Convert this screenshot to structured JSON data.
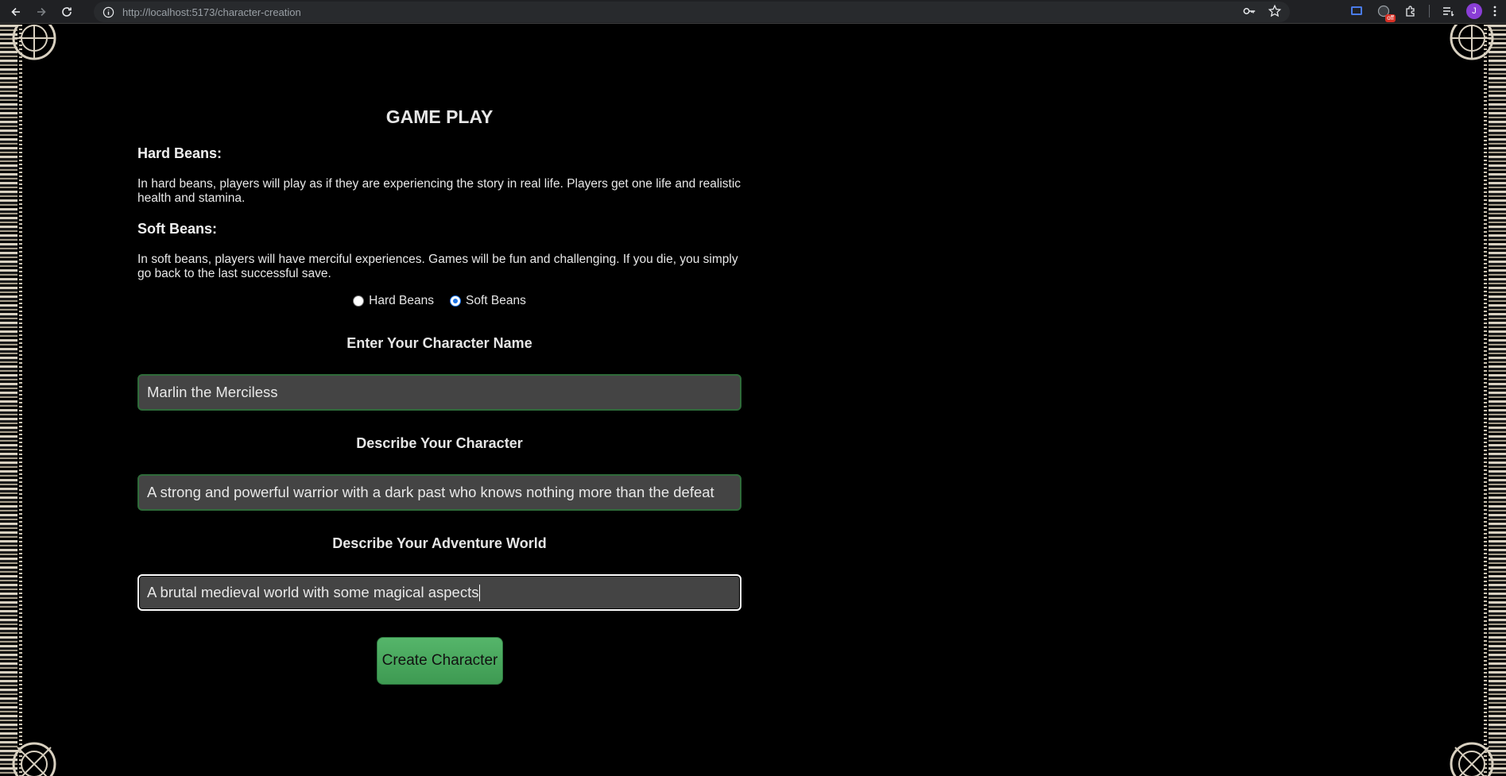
{
  "browser": {
    "url_host": "http://localhost",
    "url_rest": ":5173/character-creation",
    "profile_initial": "J",
    "extension_badge": "off"
  },
  "page": {
    "title": "GAME PLAY",
    "modes": [
      {
        "heading": "Hard Beans:",
        "description": "In hard beans, players will play as if they are experiencing the story in real life. Players get one life and realistic health and stamina."
      },
      {
        "heading": "Soft Beans:",
        "description": "In soft beans, players will have merciful experiences. Games will be fun and challenging. If you die, you simply go back to the last successful save."
      }
    ],
    "radio_options": [
      {
        "label": "Hard Beans",
        "checked": false
      },
      {
        "label": "Soft Beans",
        "checked": true
      }
    ],
    "fields": [
      {
        "label": "Enter Your Character Name",
        "value": "Marlin the Merciless"
      },
      {
        "label": "Describe Your Character",
        "value": "A strong and powerful warrior with a dark past who knows nothing more than the defeat"
      },
      {
        "label": "Describe Your Adventure World",
        "value": "A brutal medieval world with some magical aspects"
      }
    ],
    "submit_label": "Create Character"
  },
  "colors": {
    "background": "#000000",
    "field_bg": "#444444",
    "field_border": "#2f6b3a",
    "button_green": "#4caf63",
    "radio_accent": "#1a73e8"
  }
}
